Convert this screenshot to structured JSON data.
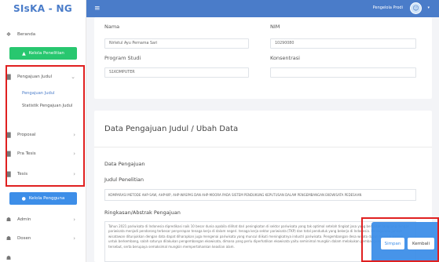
{
  "brand": "SIsKA - NG",
  "topbar": {
    "user": "Pengelola Prodi"
  },
  "sidebar": {
    "beranda": "Beranda",
    "kelola_penelitian": "Kelola Penelitian",
    "pengajuan_judul": "Pengajuan Judul",
    "sub_items": [
      "Pengajuan Judul",
      "Statistik Pengajuan Judul"
    ],
    "proposal": "Proposal",
    "pra_tesis": "Pra Tesis",
    "tesis": "Tesis",
    "kelola_pengguna": "Kelola Pengguna",
    "admin": "Admin",
    "dosen": "Dosen"
  },
  "form_top": {
    "nama_label": "Nama",
    "nama_value": "Nirletul Ayu Pernama Sari",
    "nim_label": "NIM",
    "nim_value": "10290080",
    "prodi_label": "Program Studi",
    "prodi_value": "S1KOMPUTER",
    "konsentrasi_label": "Konsentrasi",
    "konsentrasi_value": ""
  },
  "card": {
    "title": "Data Pengajuan Judul / Ubah Data",
    "section": "Data Pengajuan",
    "judul_label": "Judul Penelitian",
    "judul_value": "KOMPARASI METODE AHP-SAW, AHP-WP, AHP-WASPAS DAN AHP-MOORA PADA SISTEM PENDUKUNG KEPUTUSAN DALAM PENGEMBANGAN EKOWISATA PEDESAAN",
    "ringkasan_label": "Ringkasan/Abstrak Pengajuan",
    "ringkasan_value": "Tahun 2021 pariwisata di Indonesia dipredikasi naik 10 besar dunia apabila dilihat dari peningkatan di sektor pariwisata yang tak optimal setelah tingkat jasa yang berkaitan langsung dengan pariwisata menjadi pendorong terbesar penyerapan tenaga kerja di dalam negeri. tenaga kerja sektor pariwisata (TKP) dan total penduduk yang bekerja di Indonesia. Peningkatan jumlah wisatawan ditunjukkan dengan data dapat diharapkan juga mengenai pariwisata yang muncul diikuti meningkatnya industri pariwisata. Pengembangan desa wisata dapat menjadi bagian untuk berkembang, salah satunya dilakukan pengembangan ekowisata, dimana yang perlu diperhatikan ekowisata yaitu seminimal mungkin dalam melakukan pembangunan fisik di desa tersebut, serta berupaya semaksimal mungkin mempertahankan keaslian alam."
  },
  "actions": {
    "simpan": "Simpan",
    "kembali": "Kembali"
  },
  "colors": {
    "primary": "#4a7cc9",
    "green": "#28c76f",
    "blue": "#3d8ee8",
    "highlight": "#e02020"
  }
}
